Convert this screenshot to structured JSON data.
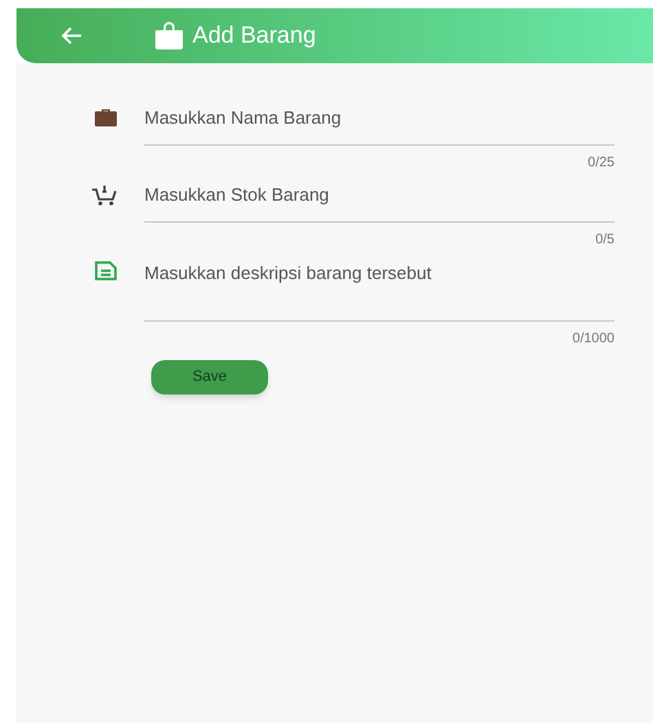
{
  "app_bar": {
    "title": "Add Barang"
  },
  "fields": [
    {
      "kind": "bag",
      "placeholder": "Masukkan Nama Barang",
      "counter": "0/25",
      "multiline": false
    },
    {
      "kind": "cart",
      "placeholder": "Masukkan Stok Barang",
      "counter": "0/5",
      "multiline": false
    },
    {
      "kind": "document",
      "placeholder": "Masukkan deskripsi barang tersebut",
      "counter": "0/1000",
      "multiline": true
    }
  ],
  "save_button": {
    "label": "Save"
  }
}
